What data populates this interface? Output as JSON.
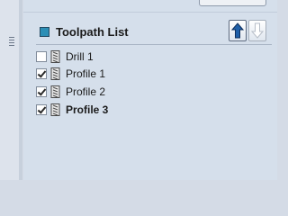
{
  "panel": {
    "title": "Toolpath List",
    "buttons": {
      "move_up_icon": "arrow-up-icon",
      "move_down_icon": "arrow-down-icon"
    }
  },
  "toolpaths": [
    {
      "label": "Drill 1",
      "checked": false,
      "bold": false,
      "icon": "drill-tool-icon"
    },
    {
      "label": "Profile 1",
      "checked": true,
      "bold": false,
      "icon": "end-mill-tool-icon"
    },
    {
      "label": "Profile 2",
      "checked": true,
      "bold": false,
      "icon": "end-mill-tool-icon"
    },
    {
      "label": "Profile 3",
      "checked": true,
      "bold": true,
      "icon": "end-mill-tool-icon"
    }
  ],
  "colors": {
    "panel_bg": "#d5dfeb",
    "header_icon": "#2c8fb6",
    "up_arrow": "#1f5fa8",
    "down_arrow_disabled": "#b7bec8"
  }
}
